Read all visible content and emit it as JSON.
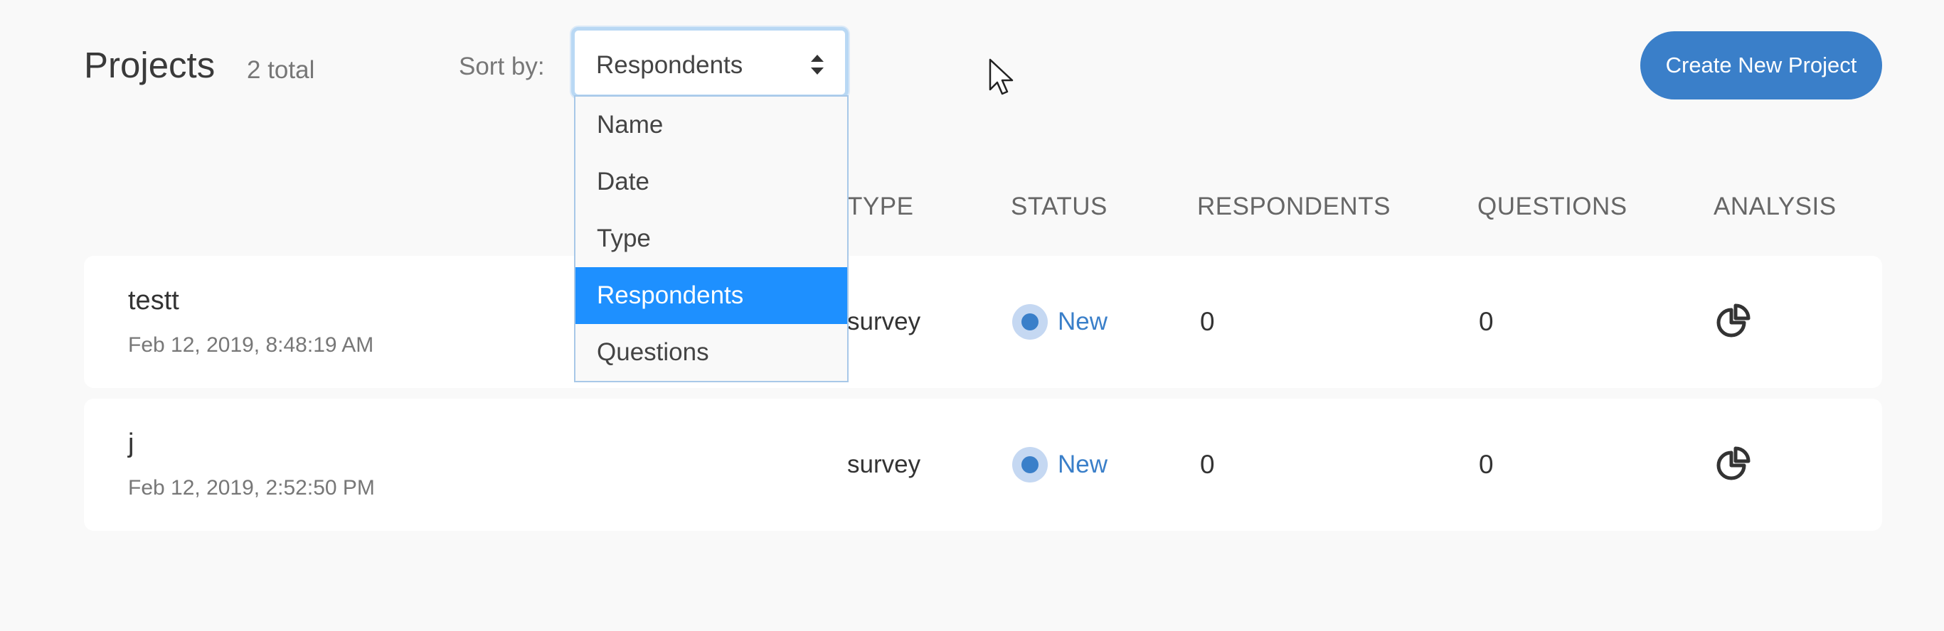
{
  "header": {
    "title": "Projects",
    "total": "2 total",
    "sort_label": "Sort by:",
    "sort_value": "Respondents",
    "create_button": "Create New Project"
  },
  "sort_options": [
    "Name",
    "Date",
    "Type",
    "Respondents",
    "Questions"
  ],
  "selected_option": "Respondents",
  "columns": {
    "type": "TYPE",
    "status": "STATUS",
    "respondents": "RESPONDENTS",
    "questions": "QUESTIONS",
    "analysis": "ANALYSIS"
  },
  "rows": [
    {
      "name": "testt",
      "date": "Feb 12, 2019, 8:48:19 AM",
      "type": "survey",
      "status": "New",
      "respondents": "0",
      "questions": "0"
    },
    {
      "name": "j",
      "date": "Feb 12, 2019, 2:52:50 PM",
      "type": "survey",
      "status": "New",
      "respondents": "0",
      "questions": "0"
    }
  ],
  "colors": {
    "accent": "#3a7fc9",
    "selected_option": "#1e90ff",
    "status_ring": "#c5d8f2",
    "background": "#f9f9f9"
  },
  "icons": {
    "analysis": "pie-chart-icon",
    "sort": "sort-arrows-icon",
    "cursor": "mouse-cursor-icon"
  }
}
